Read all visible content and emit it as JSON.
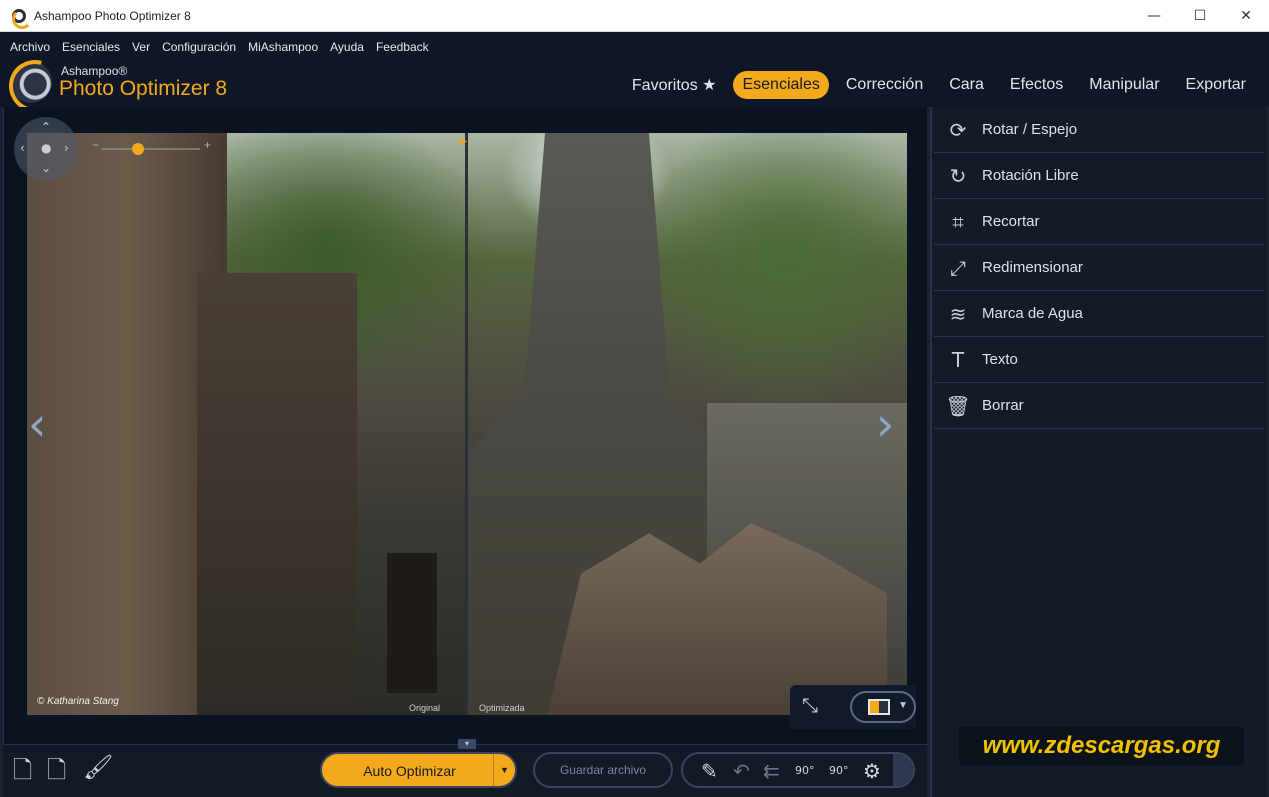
{
  "window": {
    "title": "Ashampoo Photo Optimizer 8",
    "controls": {
      "minimize": "—",
      "maximize": "☐",
      "close": "✕"
    }
  },
  "menu": [
    "Archivo",
    "Esenciales",
    "Ver",
    "Configuración",
    "MiAshampoo",
    "Ayuda",
    "Feedback"
  ],
  "brand": {
    "company": "Ashampoo®",
    "product": "Photo Optimizer 8",
    "accent_color": "#f2a91b"
  },
  "tabs": [
    {
      "label": "Favoritos ★",
      "active": false
    },
    {
      "label": "Esenciales",
      "active": true
    },
    {
      "label": "Corrección",
      "active": false
    },
    {
      "label": "Cara",
      "active": false
    },
    {
      "label": "Efectos",
      "active": false
    },
    {
      "label": "Manipular",
      "active": false
    },
    {
      "label": "Exportar",
      "active": false
    }
  ],
  "viewer": {
    "credit": "© Katharina Stang",
    "label_original": "Original",
    "label_optimized": "Optimizada",
    "zoom": {
      "minus": "−",
      "plus": "+"
    }
  },
  "panel_items": [
    {
      "label": "Rotar / Espejo",
      "icon": "rotate-mirror-icon",
      "glyph": "⟳"
    },
    {
      "label": "Rotación Libre",
      "icon": "free-rotate-icon",
      "glyph": "↻"
    },
    {
      "label": "Recortar",
      "icon": "crop-icon",
      "glyph": "⌗"
    },
    {
      "label": "Redimensionar",
      "icon": "resize-icon",
      "glyph": "⤢"
    },
    {
      "label": "Marca de Agua",
      "icon": "watermark-icon",
      "glyph": "≋"
    },
    {
      "label": "Texto",
      "icon": "text-icon",
      "glyph": "T"
    },
    {
      "label": "Borrar",
      "icon": "trash-icon",
      "glyph": "🗑"
    }
  ],
  "watermark_overlay": "www.zdescargas.org",
  "bottom": {
    "auto_optimize": "Auto Optimizar",
    "save": "Guardar archivo",
    "rotate_left": "90°",
    "rotate_right": "90°"
  }
}
